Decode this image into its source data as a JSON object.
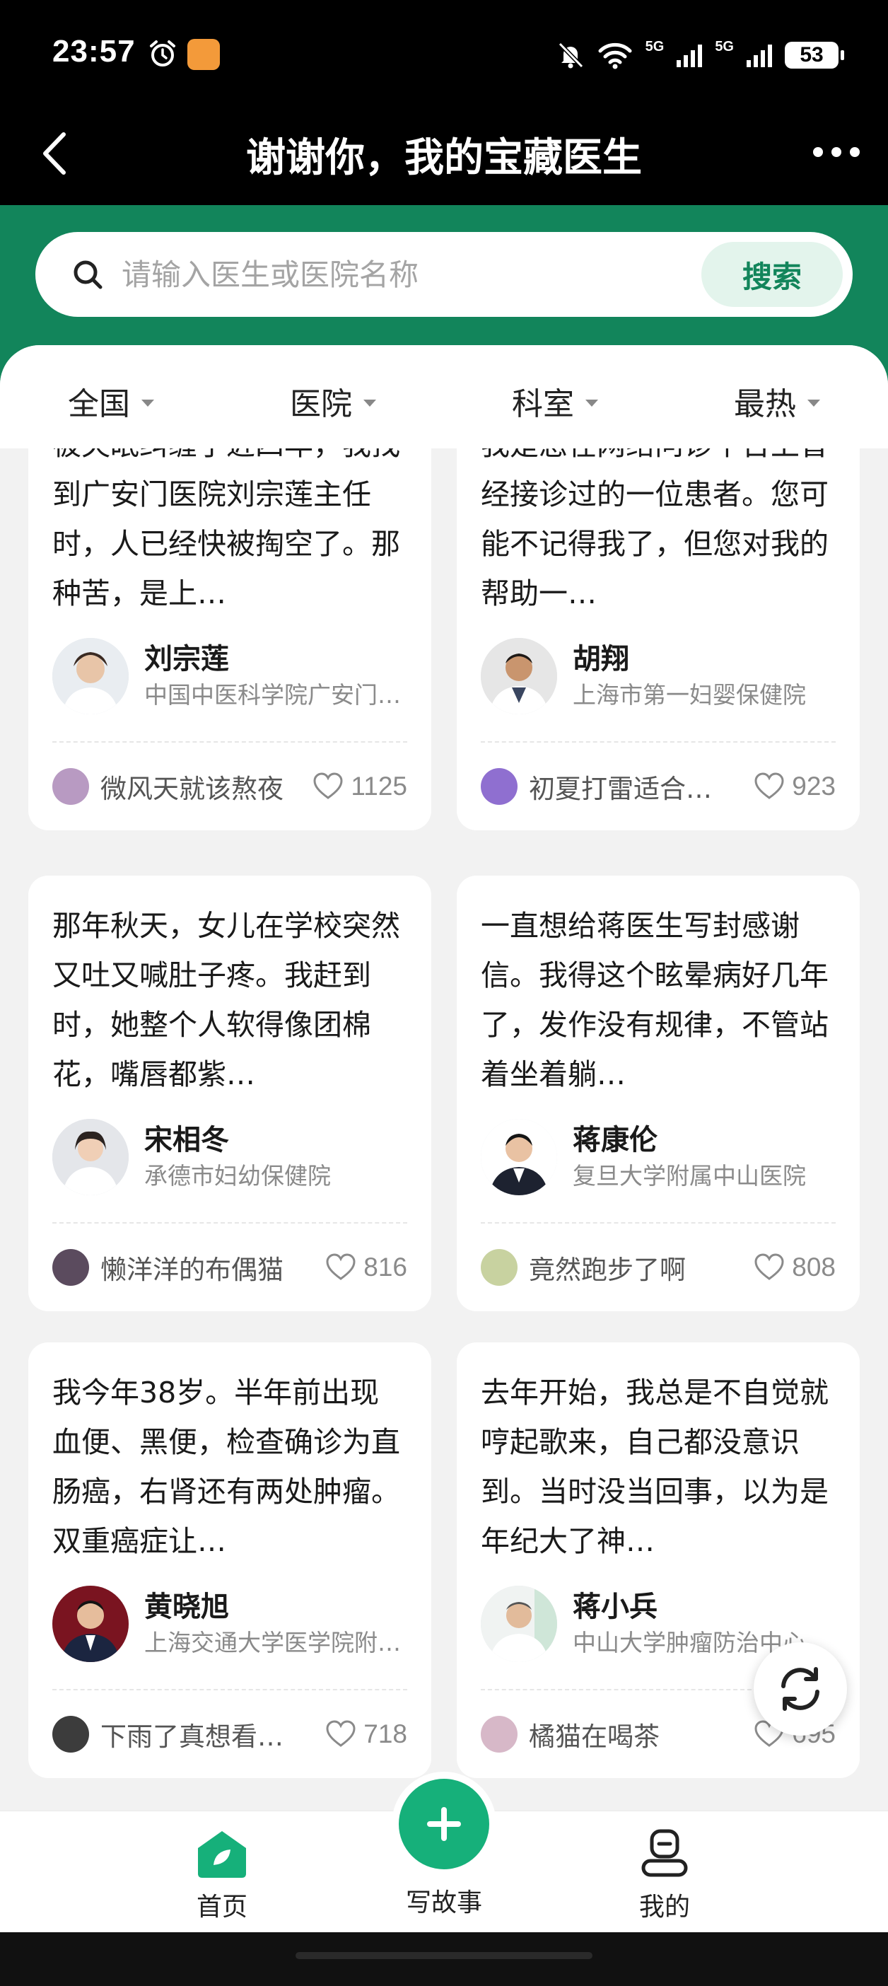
{
  "status_bar": {
    "time": "23:57",
    "network_1": "5G",
    "network_2": "5G",
    "battery": "53"
  },
  "header": {
    "title": "谢谢你，我的宝藏医生"
  },
  "search": {
    "placeholder": "请输入医生或医院名称",
    "button_label": "搜索"
  },
  "filters": [
    {
      "label": "全国"
    },
    {
      "label": "医院"
    },
    {
      "label": "科室"
    },
    {
      "label": "最热"
    }
  ],
  "cards": [
    {
      "text": "被失眠纠缠了近四年，我找到广安门医院刘宗莲主任时，人已经快被掏空了。那种苦，是上…",
      "doctor": "刘宗莲",
      "hospital": "中国中医科学院广安门医院",
      "user": "微风天就该熬夜",
      "likes": "1125"
    },
    {
      "text": "我是您在网络问诊平台上曾经接诊过的一位患者。您可能不记得我了，但您对我的帮助一…",
      "doctor": "胡翔",
      "hospital": "上海市第一妇婴保健院",
      "user": "初夏打雷适合…",
      "likes": "923"
    },
    {
      "text": "那年秋天，女儿在学校突然又吐又喊肚子疼。我赶到时，她整个人软得像团棉花，嘴唇都紫…",
      "doctor": "宋相冬",
      "hospital": "承德市妇幼保健院",
      "user": "懒洋洋的布偶猫",
      "likes": "816"
    },
    {
      "text": "一直想给蒋医生写封感谢信。我得这个眩晕病好几年了，发作没有规律，不管站着坐着躺…",
      "doctor": "蒋康伦",
      "hospital": "复旦大学附属中山医院",
      "user": "竟然跑步了啊",
      "likes": "808"
    },
    {
      "text": "我今年38岁。半年前出现血便、黑便，检查确诊为直肠癌，右肾还有两处肿瘤。双重癌症让…",
      "doctor": "黄晓旭",
      "hospital": "上海交通大学医学院附属医院",
      "user": "下雨了真想看…",
      "likes": "718"
    },
    {
      "text": "去年开始，我总是不自觉就哼起歌来，自己都没意识到。当时没当回事，以为是年纪大了神…",
      "doctor": "蒋小兵",
      "hospital": "中山大学肿瘤防治中心",
      "user": "橘猫在喝茶",
      "likes": "695"
    }
  ],
  "bottom_nav": {
    "home": "首页",
    "write": "写故事",
    "mine": "我的"
  },
  "colors": {
    "brand_green": "#12855b",
    "fab_green": "#16b07a"
  }
}
